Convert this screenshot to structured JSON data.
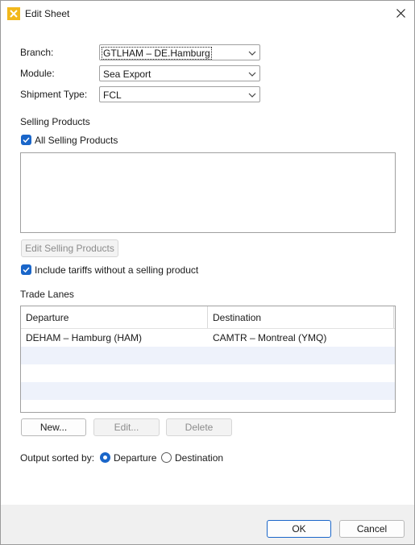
{
  "window": {
    "title": "Edit Sheet"
  },
  "icons": {
    "app": "app-logo-icon",
    "close": "close-icon",
    "chevron": "chevron-down-icon",
    "check": "checkmark-icon"
  },
  "colors": {
    "accent": "#1a66c9",
    "alt_row": "#eef2fb",
    "footer_bg": "#f0f0f0"
  },
  "form": {
    "branch": {
      "label": "Branch:",
      "value": "GTLHAM – DE.Hamburg"
    },
    "module": {
      "label": "Module:",
      "value": "Sea Export"
    },
    "shipment_type": {
      "label": "Shipment Type:",
      "value": "FCL"
    }
  },
  "selling_products": {
    "heading": "Selling Products",
    "all_checkbox": {
      "label": "All Selling Products",
      "checked": true
    },
    "edit_button": "Edit Selling Products",
    "include_checkbox": {
      "label": "Include tariffs without a selling product",
      "checked": true
    }
  },
  "trade_lanes": {
    "heading": "Trade Lanes",
    "columns": [
      "Departure",
      "Destination"
    ],
    "rows": [
      {
        "departure": "DEHAM – Hamburg (HAM)",
        "destination": "CAMTR – Montreal (YMQ)"
      }
    ],
    "buttons": {
      "new": "New...",
      "edit": "Edit...",
      "delete": "Delete"
    }
  },
  "output": {
    "label": "Output sorted by:",
    "options": [
      "Departure",
      "Destination"
    ],
    "selected": "Departure"
  },
  "footer": {
    "ok": "OK",
    "cancel": "Cancel"
  }
}
